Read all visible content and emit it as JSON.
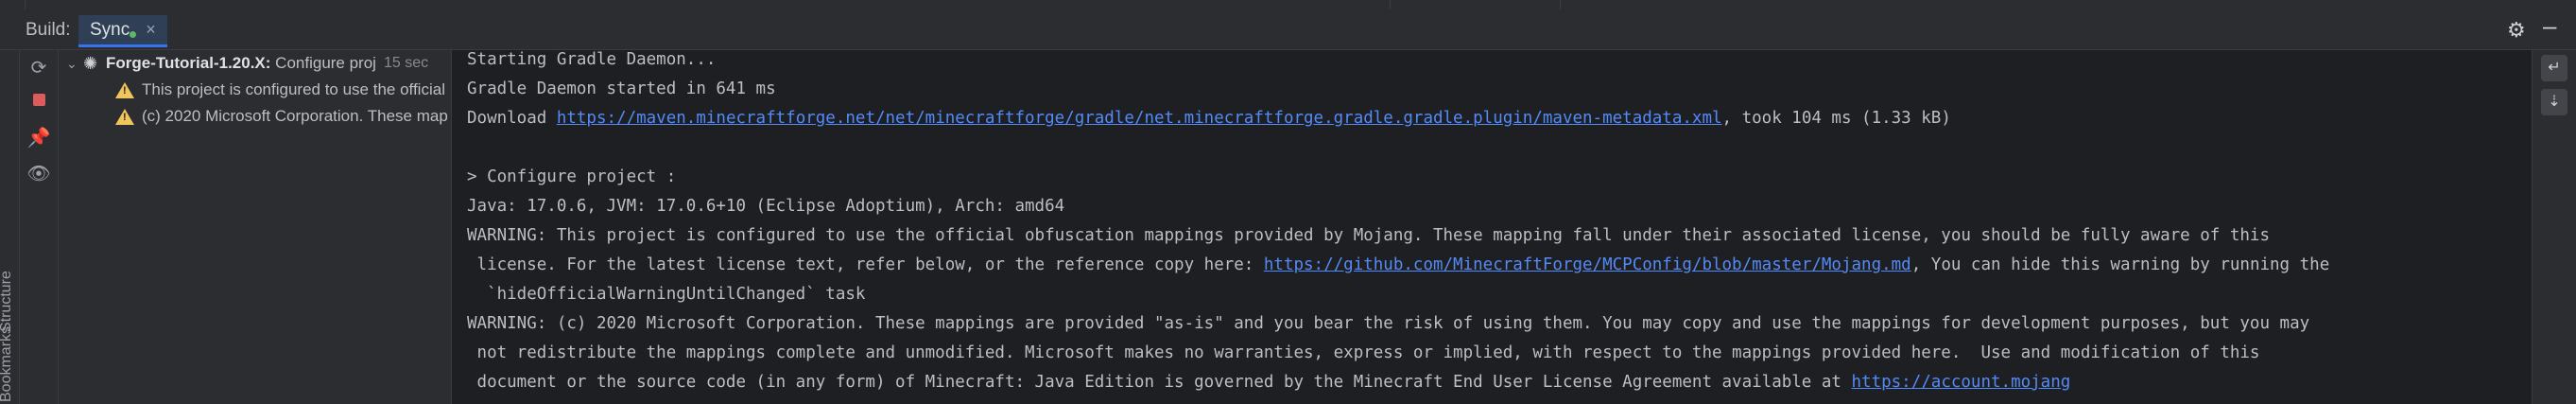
{
  "header": {
    "build_label": "Build:",
    "tab_label": "Sync",
    "tab_close": "×"
  },
  "left_strip": {
    "structure_label": "Structure",
    "bookmarks_label": "Bookmarks"
  },
  "tree": {
    "project_name": "Forge-Tutorial-1.20.X:",
    "project_status": "Configure proj",
    "project_time": "15 sec",
    "warnings": [
      "This project is configured to use the official",
      "(c) 2020 Microsoft Corporation. These map"
    ]
  },
  "console": {
    "lines": [
      {
        "text": "Starting Gradle Daemon..."
      },
      {
        "text": "Gradle Daemon started in 641 ms"
      },
      {
        "text": "Download ",
        "link": "https://maven.minecraftforge.net/net/minecraftforge/gradle/net.minecraftforge.gradle.gradle.plugin/maven-metadata.xml",
        "after": ", took 104 ms (1.33 kB)"
      },
      {
        "text": ""
      },
      {
        "text": "> Configure project :"
      },
      {
        "text": "Java: 17.0.6, JVM: 17.0.6+10 (Eclipse Adoptium), Arch: amd64"
      },
      {
        "text": "WARNING: This project is configured to use the official obfuscation mappings provided by Mojang. These mapping fall under their associated license, you should be fully aware of this"
      },
      {
        "text": " license. For the latest license text, refer below, or the reference copy here: ",
        "link": "https://github.com/MinecraftForge/MCPConfig/blob/master/Mojang.md",
        "after": ", You can hide this warning by running the"
      },
      {
        "text": "  `hideOfficialWarningUntilChanged` task"
      },
      {
        "text": "WARNING: (c) 2020 Microsoft Corporation. These mappings are provided \"as-is\" and you bear the risk of using them. You may copy and use the mappings for development purposes, but you may"
      },
      {
        "text": " not redistribute the mappings complete and unmodified. Microsoft makes no warranties, express or implied, with respect to the mappings provided here.  Use and modification of this"
      },
      {
        "text": " document or the source code (in any form) of Minecraft: Java Edition is governed by the Minecraft End User License Agreement available at ",
        "link": "https://account.mojang",
        "after": ""
      }
    ]
  }
}
